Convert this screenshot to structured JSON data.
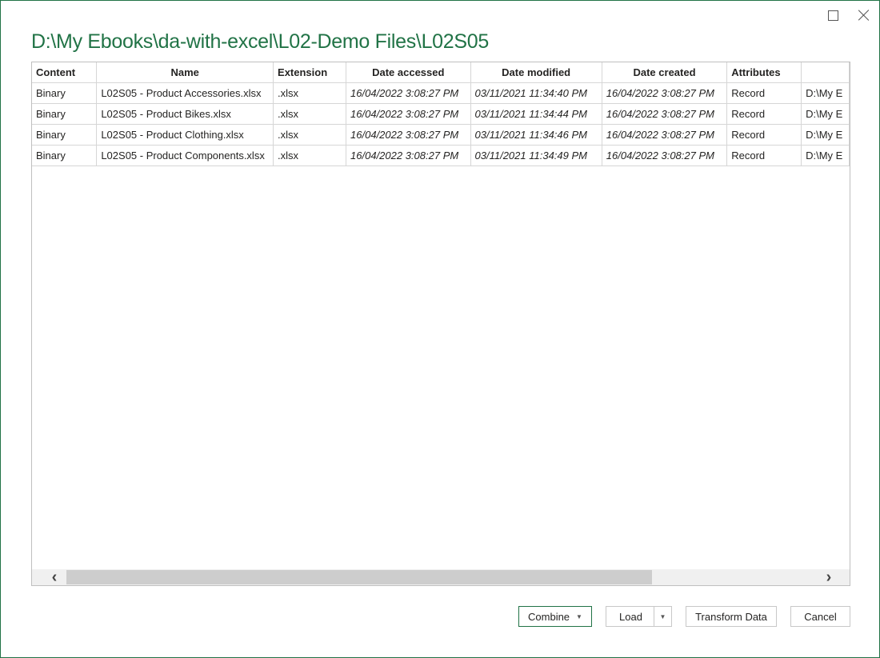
{
  "window": {
    "title": "D:\\My Ebooks\\da-with-excel\\L02-Demo Files\\L02S05",
    "accent_color": "#217346"
  },
  "grid": {
    "headers": [
      "Content",
      "Name",
      "Extension",
      "Date accessed",
      "Date modified",
      "Date created",
      "Attributes",
      ""
    ],
    "rows": [
      [
        "Binary",
        "L02S05 - Product Accessories.xlsx",
        ".xlsx",
        "16/04/2022 3:08:27 PM",
        "03/11/2021 11:34:40 PM",
        "16/04/2022 3:08:27 PM",
        "Record",
        "D:\\My E"
      ],
      [
        "Binary",
        "L02S05 - Product Bikes.xlsx",
        ".xlsx",
        "16/04/2022 3:08:27 PM",
        "03/11/2021 11:34:44 PM",
        "16/04/2022 3:08:27 PM",
        "Record",
        "D:\\My E"
      ],
      [
        "Binary",
        "L02S05 - Product Clothing.xlsx",
        ".xlsx",
        "16/04/2022 3:08:27 PM",
        "03/11/2021 11:34:46 PM",
        "16/04/2022 3:08:27 PM",
        "Record",
        "D:\\My E"
      ],
      [
        "Binary",
        "L02S05 - Product Components.xlsx",
        ".xlsx",
        "16/04/2022 3:08:27 PM",
        "03/11/2021 11:34:49 PM",
        "16/04/2022 3:08:27 PM",
        "Record",
        "D:\\My E"
      ]
    ]
  },
  "scrollbar": {
    "left_icon": "chevron-left-icon",
    "right_icon": "chevron-right-icon"
  },
  "footer": {
    "combine_label": "Combine",
    "load_label": "Load",
    "transform_label": "Transform Data",
    "cancel_label": "Cancel"
  }
}
